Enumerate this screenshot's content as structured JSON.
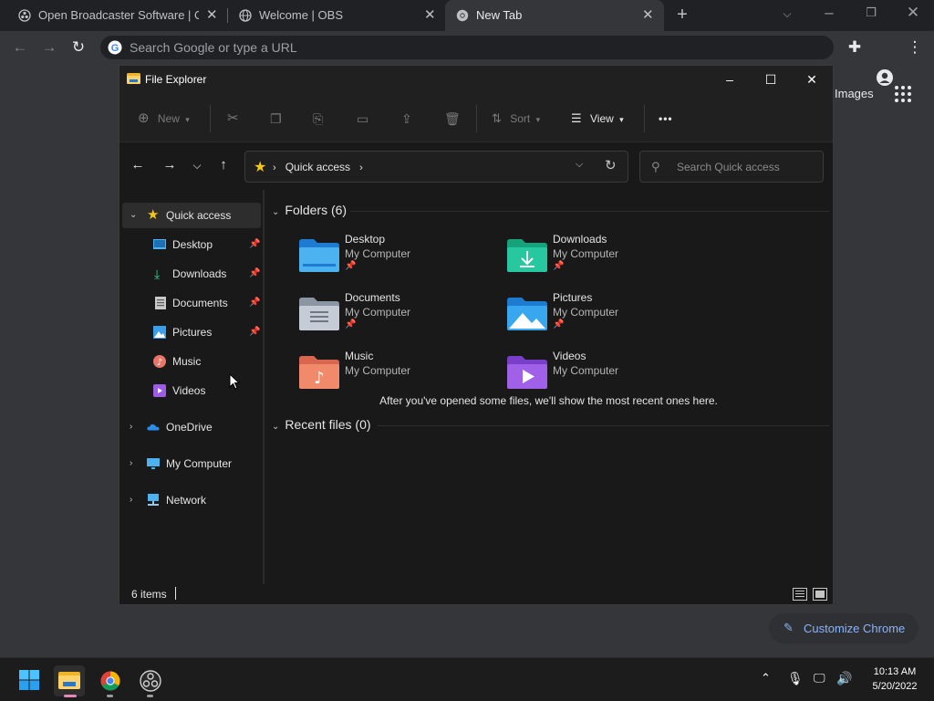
{
  "browser": {
    "tabs": [
      {
        "label": "Open Broadcaster Software | OBS",
        "active": false
      },
      {
        "label": "Welcome | OBS",
        "active": false
      },
      {
        "label": "New Tab",
        "active": true
      }
    ],
    "omnibox_placeholder": "Search Google or type a URL",
    "page": {
      "images_link": "Images",
      "customize_label": "Customize Chrome"
    }
  },
  "explorer": {
    "title": "File Explorer",
    "commands": {
      "new": "New",
      "sort": "Sort",
      "view": "View",
      "more": "•••"
    },
    "address": {
      "location": "Quick access"
    },
    "search_placeholder": "Search Quick access",
    "nav": {
      "quick_access": "Quick access",
      "pinned": [
        {
          "label": "Desktop",
          "pinned": true
        },
        {
          "label": "Downloads",
          "pinned": true
        },
        {
          "label": "Documents",
          "pinned": true
        },
        {
          "label": "Pictures",
          "pinned": true
        },
        {
          "label": "Music",
          "pinned": false
        },
        {
          "label": "Videos",
          "pinned": false
        }
      ],
      "onedrive": "OneDrive",
      "my_computer": "My Computer",
      "network": "Network"
    },
    "folders_header": "Folders (6)",
    "folders": [
      {
        "name": "Desktop",
        "location": "My Computer",
        "pinned": true
      },
      {
        "name": "Downloads",
        "location": "My Computer",
        "pinned": true
      },
      {
        "name": "Documents",
        "location": "My Computer",
        "pinned": true
      },
      {
        "name": "Pictures",
        "location": "My Computer",
        "pinned": true
      },
      {
        "name": "Music",
        "location": "My Computer",
        "pinned": false
      },
      {
        "name": "Videos",
        "location": "My Computer",
        "pinned": false
      }
    ],
    "recent_header": "Recent files (0)",
    "recent_empty": "After you've opened some files, we'll show the most recent ones here.",
    "status_count": "6 items"
  },
  "taskbar": {
    "time": "10:13 AM",
    "date": "5/20/2022"
  },
  "colors": {
    "chrome_dark": "#202124",
    "chrome_toolbar": "#35363a",
    "explorer_bg": "#191919",
    "accent_blue": "#8ab4f8",
    "quick_access_star": "#f5c518"
  }
}
